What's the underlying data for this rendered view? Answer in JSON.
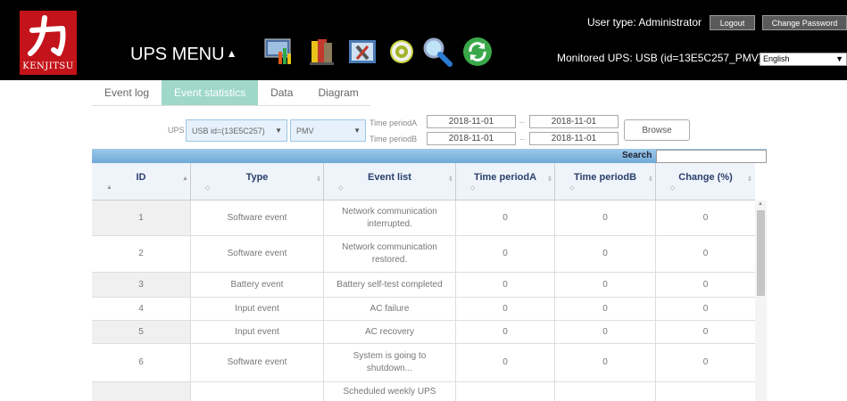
{
  "header": {
    "logo_text": "KENJITSU",
    "menu_title": "UPS MENU",
    "menu_arrow": "▲",
    "toolbar_icons": [
      "chart-icon",
      "documents-icon",
      "tools-icon",
      "settings-gear-icon",
      "magnifier-icon",
      "refresh-icon"
    ],
    "user_type": "User type: Administrator",
    "logout_label": "Logout",
    "change_password_label": "Change Password",
    "monitored_ups": "Monitored UPS: USB (id=13E5C257_PMV)",
    "language": "English",
    "accent_color": "#c4141b"
  },
  "tabs": [
    {
      "label": "Event log",
      "active": false
    },
    {
      "label": "Event statistics",
      "active": true
    },
    {
      "label": "Data",
      "active": false
    },
    {
      "label": "Diagram",
      "active": false
    }
  ],
  "filters": {
    "ups_label": "UPS",
    "ups_value": "USB id=(13E5C257)",
    "model_value": "PMV",
    "period_a_label": "Time periodA",
    "period_b_label": "Time periodB",
    "period_a_from": "2018-11-01",
    "period_a_to": "2018-11-01",
    "period_b_from": "2018-11-01",
    "period_b_to": "2018-11-01",
    "dash": "--",
    "browse_label": "Browse"
  },
  "search": {
    "label": "Search",
    "value": ""
  },
  "table": {
    "columns": [
      "ID",
      "Type",
      "Event list",
      "Time periodA",
      "Time periodB",
      "Change (%)"
    ],
    "rows": [
      {
        "id": "1",
        "type": "Software event",
        "event": "Network communication interrupted.",
        "a": "0",
        "b": "0",
        "change": "0"
      },
      {
        "id": "2",
        "type": "Software event",
        "event": "Network communication restored.",
        "a": "0",
        "b": "0",
        "change": "0"
      },
      {
        "id": "3",
        "type": "Battery event",
        "event": "Battery self-test completed",
        "a": "0",
        "b": "0",
        "change": "0"
      },
      {
        "id": "4",
        "type": "Input event",
        "event": "AC failure",
        "a": "0",
        "b": "0",
        "change": "0"
      },
      {
        "id": "5",
        "type": "Input event",
        "event": "AC recovery",
        "a": "0",
        "b": "0",
        "change": "0"
      },
      {
        "id": "6",
        "type": "Software event",
        "event": "System is going to shutdown...",
        "a": "0",
        "b": "0",
        "change": "0"
      },
      {
        "id": "",
        "type": "",
        "event": "Scheduled weekly UPS",
        "a": "",
        "b": "",
        "change": ""
      }
    ]
  }
}
